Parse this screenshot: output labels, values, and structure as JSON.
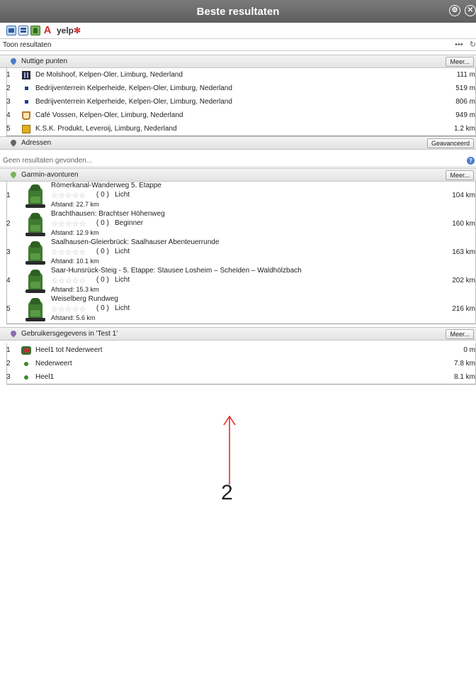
{
  "window": {
    "title": "Beste resultaten"
  },
  "toolbar": {
    "yelp_label": "yelp"
  },
  "results_row": {
    "label": "Toon resultaten",
    "more": "•••",
    "refresh": "↻"
  },
  "sections": {
    "nuttige": {
      "title": "Nuttige punten",
      "button": "Meer...",
      "items": [
        {
          "num": "1",
          "name": "De Molshoof, Kelpen-Oler, Limburg, Nederland",
          "dist": "111 m",
          "icon": "restaurant-icon"
        },
        {
          "num": "2",
          "name": "Bedrijventerrein Kelperheide, Kelpen-Oler, Limburg, Nederland",
          "dist": "519 m",
          "icon": "poi-square-icon"
        },
        {
          "num": "3",
          "name": "Bedrijventerrein Kelperheide, Kelpen-Oler, Limburg, Nederland",
          "dist": "806 m",
          "icon": "poi-square-icon"
        },
        {
          "num": "4",
          "name": "Café Vossen, Kelpen-Oler, Limburg, Nederland",
          "dist": "949 m",
          "icon": "cafe-icon"
        },
        {
          "num": "5",
          "name": "K.S.K. Produkt, Leveroij, Limburg, Nederland",
          "dist": "1.2 km",
          "icon": "product-icon"
        }
      ]
    },
    "adressen": {
      "title": "Adressen",
      "button": "Geavanceerd",
      "placeholder": "Geen resultaten gevonden..."
    },
    "garmin": {
      "title": "Garmin-avonturen",
      "button": "Meer...",
      "items": [
        {
          "num": "1",
          "title": "Römerkanal-Wanderweg 5. Etappe",
          "stars": "☆☆☆☆☆",
          "count": "( 0 )",
          "level": "Licht",
          "afstand": "Afstand: 22.7 km",
          "dist": "104 km"
        },
        {
          "num": "2",
          "title": "Brachthausen: Brachtser Höhenweg",
          "stars": "☆☆☆☆☆",
          "count": "( 0 )",
          "level": "Beginner",
          "afstand": "Afstand: 12.9 km",
          "dist": "160 km"
        },
        {
          "num": "3",
          "title": "Saalhausen-Gleierbrück: Saalhauser Abenteuerrunde",
          "stars": "☆☆☆☆☆",
          "count": "( 0 )",
          "level": "Licht",
          "afstand": "Afstand: 10.1 km",
          "dist": "163 km"
        },
        {
          "num": "4",
          "title": "Saar-Hunsrück-Steig - 5. Etappe: Stausee Losheim – Scheiden – Waldhölzbach",
          "stars": "☆☆☆☆☆",
          "count": "( 0 )",
          "level": "Licht",
          "afstand": "Afstand: 15.3 km",
          "dist": "202 km"
        },
        {
          "num": "5",
          "title": "Weiselberg Rundweg",
          "stars": "☆☆☆☆☆",
          "count": "( 0 )",
          "level": "Licht",
          "afstand": "Afstand: 5.6 km",
          "dist": "216 km"
        }
      ]
    },
    "gebruikers": {
      "title": "Gebruikersgegevens in 'Test 1'",
      "button": "Meer...",
      "items": [
        {
          "num": "1",
          "name": "Heel1 tot Nederweert",
          "dist": "0 m",
          "icon": "route-icon"
        },
        {
          "num": "2",
          "name": "Nederweert",
          "dist": "7.8 km",
          "icon": "waypoint-dot-icon"
        },
        {
          "num": "3",
          "name": "Heel1",
          "dist": "8.1 km",
          "icon": "waypoint-dot-icon"
        }
      ]
    }
  },
  "annotation": {
    "label": "2",
    "color": "#e02020"
  }
}
